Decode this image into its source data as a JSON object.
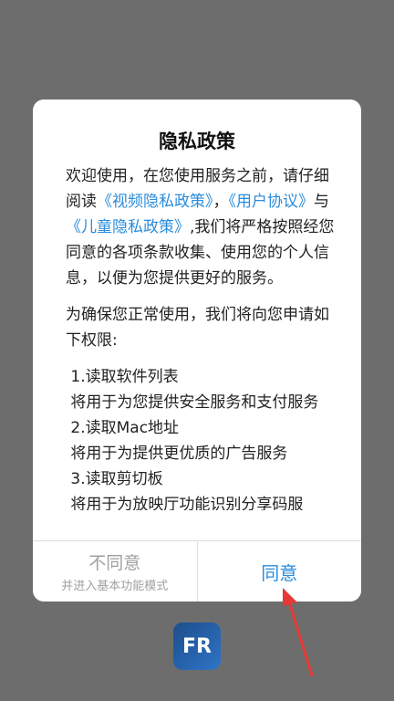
{
  "dialog": {
    "title": "隐私政策",
    "intro_1": "欢迎使用，在您使用服务之前，请仔细阅读",
    "link_video": "《视频隐私政策》",
    "sep_comma": "，",
    "link_user": "《用户协议》",
    "and": "与",
    "link_child": "《儿童隐私政策》",
    "intro_2": ",我们将严格按照经您同意的各项条款收集、使用您的个人信息，以便为您提供更好的服务。",
    "perm_intro": "为确保您正常使用，我们将向您申请如下权限:",
    "permissions": [
      {
        "title": " 1.读取软件列表",
        "desc": " 将用于为您提供安全服务和支付服务"
      },
      {
        "title": " 2.读取Mac地址",
        "desc": " 将用于为提供更优质的广告服务"
      },
      {
        "title": " 3.读取剪切板",
        "desc": " 将用于为放映厅功能识别分享码服"
      }
    ],
    "disagree_label": "不同意",
    "disagree_sub": "并进入基本功能模式",
    "agree_label": "同意"
  },
  "app_icon": {
    "text": "FR"
  },
  "colors": {
    "link": "#2a8cdc",
    "overlay": "#6d6d6d",
    "arrow": "#e53935"
  }
}
